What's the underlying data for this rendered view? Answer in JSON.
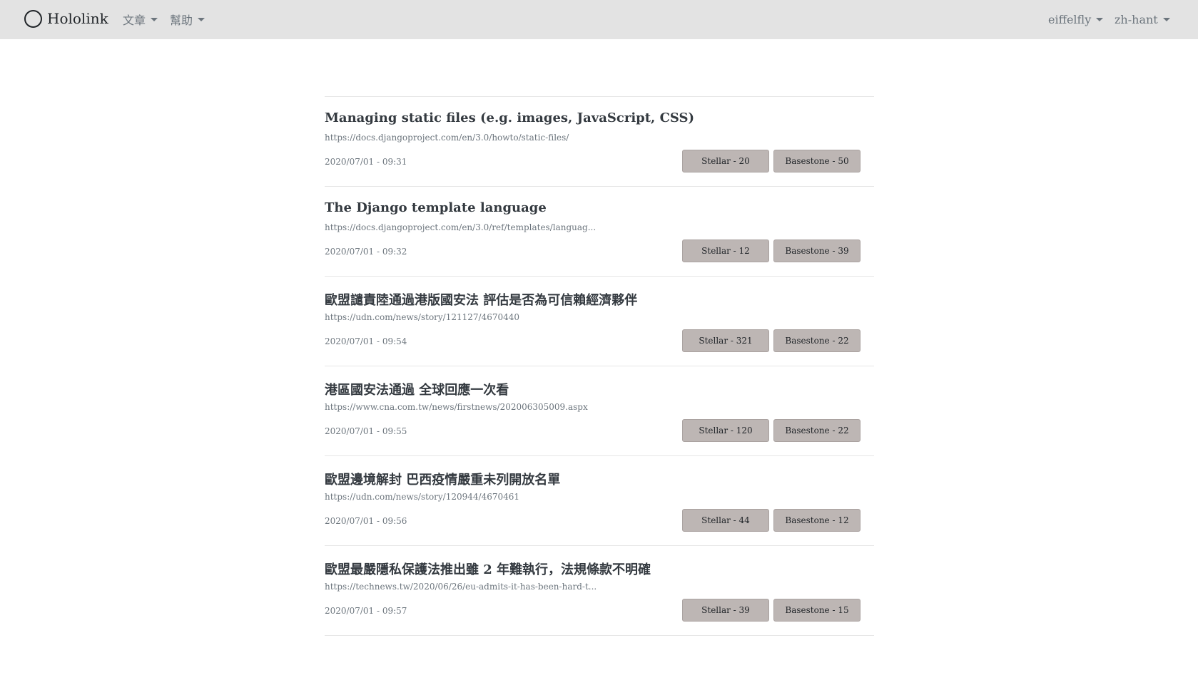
{
  "navbar": {
    "brand": "Hololink",
    "menu_articles": "文章",
    "menu_help": "幫助",
    "user": "eiffelfly",
    "language": "zh-hant"
  },
  "articles": [
    {
      "title": "Managing static files (e.g. images, JavaScript, CSS)",
      "url": "https://docs.djangoproject.com/en/3.0/howto/static-files/",
      "date": "2020/07/01 - 09:31",
      "stellar": "Stellar - 20",
      "basestone": "Basestone - 50"
    },
    {
      "title": "The Django template language",
      "url": "https://docs.djangoproject.com/en/3.0/ref/templates/languag...",
      "date": "2020/07/01 - 09:32",
      "stellar": "Stellar - 12",
      "basestone": "Basestone - 39"
    },
    {
      "title": "歐盟譴責陸通過港版國安法 評估是否為可信賴經濟夥伴",
      "url": "https://udn.com/news/story/121127/4670440",
      "date": "2020/07/01 - 09:54",
      "stellar": "Stellar - 321",
      "basestone": "Basestone - 22"
    },
    {
      "title": "港區國安法通過 全球回應一次看",
      "url": "https://www.cna.com.tw/news/firstnews/202006305009.aspx",
      "date": "2020/07/01 - 09:55",
      "stellar": "Stellar - 120",
      "basestone": "Basestone - 22"
    },
    {
      "title": "歐盟邊境解封 巴西疫情嚴重未列開放名單",
      "url": "https://udn.com/news/story/120944/4670461",
      "date": "2020/07/01 - 09:56",
      "stellar": "Stellar - 44",
      "basestone": "Basestone - 12"
    },
    {
      "title": "歐盟最嚴隱私保護法推出雖 2 年難執行，法規條款不明確",
      "url": "https://technews.tw/2020/06/26/eu-admits-it-has-been-hard-t...",
      "date": "2020/07/01 - 09:57",
      "stellar": "Stellar - 39",
      "basestone": "Basestone - 15"
    }
  ]
}
